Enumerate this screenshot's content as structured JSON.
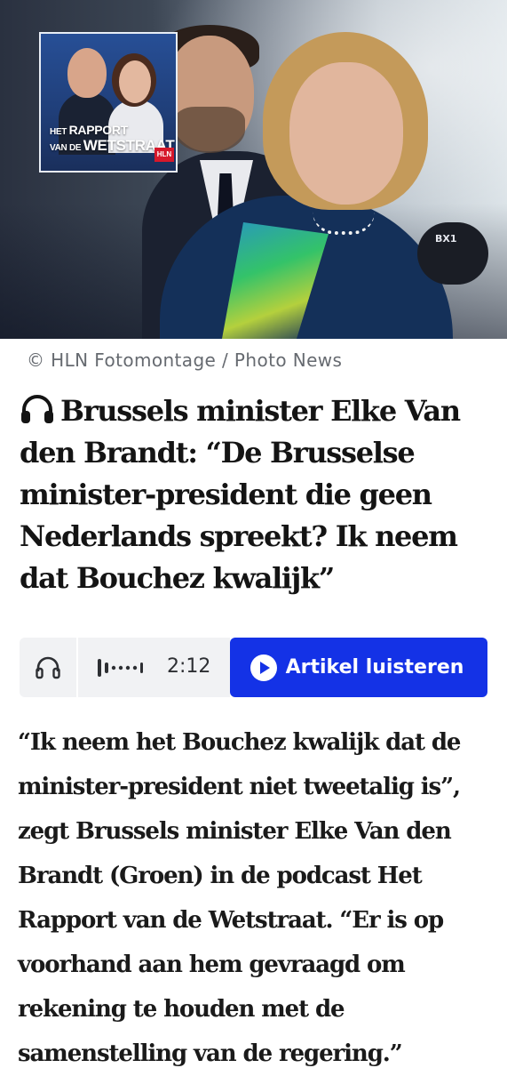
{
  "hero": {
    "thumbnail": {
      "line1_small": "HET",
      "line1_big": "RAPPORT",
      "line2_small": "VAN DE",
      "line2_big": "WETSTRAAT",
      "badge": "HLN"
    },
    "mic_label": "BX1"
  },
  "credit": "© HLN Fotomontage / Photo News",
  "headline": "Brussels minister Elke Van den Brandt: “De Brusselse minister-president die geen Nederlands spreekt? Ik neem dat Bouchez kwalijk”",
  "audio": {
    "duration": "2:12",
    "play_label": "Artikel luisteren",
    "colors": {
      "play_bg": "#1432e6",
      "bar_bg": "#f1f2f4"
    }
  },
  "lead": "“Ik neem het Bouchez kwalijk dat de minister-president niet tweetalig is”, zegt Brussels minister Elke Van den Brandt (Groen) in de podcast Het Rapport van de Wetstraat. “Er is op voorhand aan hem gevraagd om rekening te houden met de samenstelling van de regering.”"
}
